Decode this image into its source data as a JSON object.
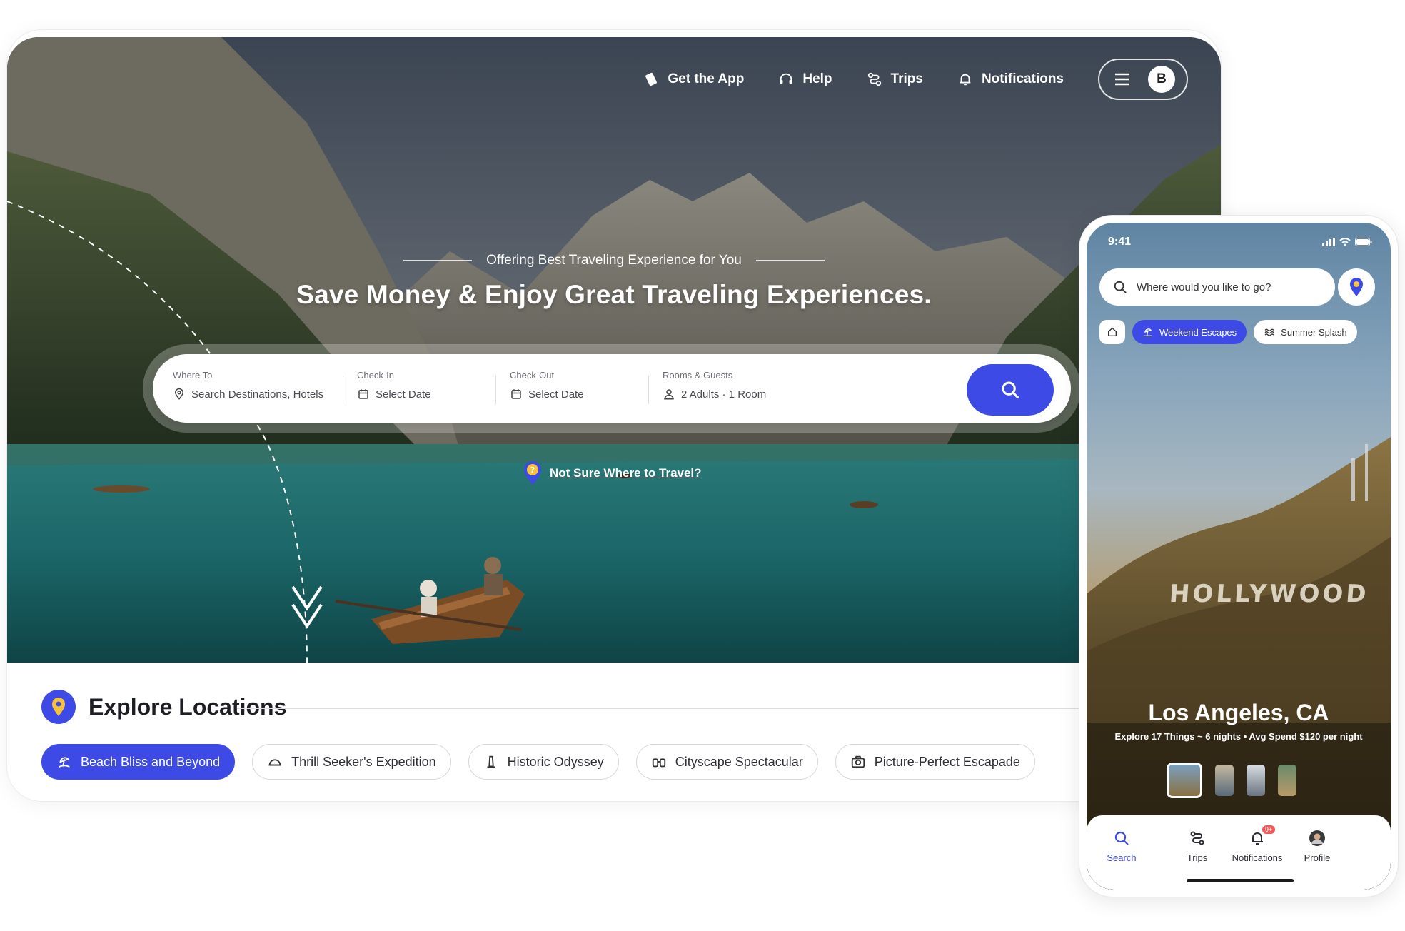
{
  "nav": {
    "get_app": "Get the App",
    "help": "Help",
    "trips": "Trips",
    "notifications": "Notifications",
    "avatar_initial": "B"
  },
  "hero": {
    "tagline": "Offering Best Traveling Experience for You",
    "headline": "Save Money & Enjoy Great Traveling Experiences.",
    "not_sure": "Not Sure Where to Travel?"
  },
  "search": {
    "where_label": "Where To",
    "where_placeholder": "Search Destinations, Hotels",
    "checkin_label": "Check-In",
    "checkin_value": "Select Date",
    "checkout_label": "Check-Out",
    "checkout_value": "Select Date",
    "guests_label": "Rooms & Guests",
    "guests_value": "2 Adults · 1 Room"
  },
  "explore": {
    "title": "Explore Locations",
    "chips": [
      {
        "label": "Beach Bliss and Beyond",
        "icon": "beach-icon",
        "active": true
      },
      {
        "label": "Thrill Seeker's Expedition",
        "icon": "helmet-icon",
        "active": false
      },
      {
        "label": "Historic Odyssey",
        "icon": "monument-icon",
        "active": false
      },
      {
        "label": "Cityscape Spectacular",
        "icon": "binoculars-icon",
        "active": false
      },
      {
        "label": "Picture-Perfect Escapade",
        "icon": "camera-icon",
        "active": false
      }
    ]
  },
  "mobile": {
    "time": "9:41",
    "search_placeholder": "Where would you like to go?",
    "chips": [
      {
        "label": "Weekend Escapes",
        "active": true
      },
      {
        "label": "Summer Splash",
        "active": false
      }
    ],
    "sign_text": "HOLLYWOOD",
    "city": "Los Angeles, CA",
    "city_sub": "Explore 17 Things ~ 6 nights  •  Avg Spend $120 per night",
    "tabs": [
      {
        "label": "Search"
      },
      {
        "label": "Trips"
      },
      {
        "label": "Notifications",
        "badge": "9+"
      },
      {
        "label": "Profile"
      }
    ]
  },
  "colors": {
    "accent": "#3d4ae6",
    "badge": "#f05a5a"
  }
}
